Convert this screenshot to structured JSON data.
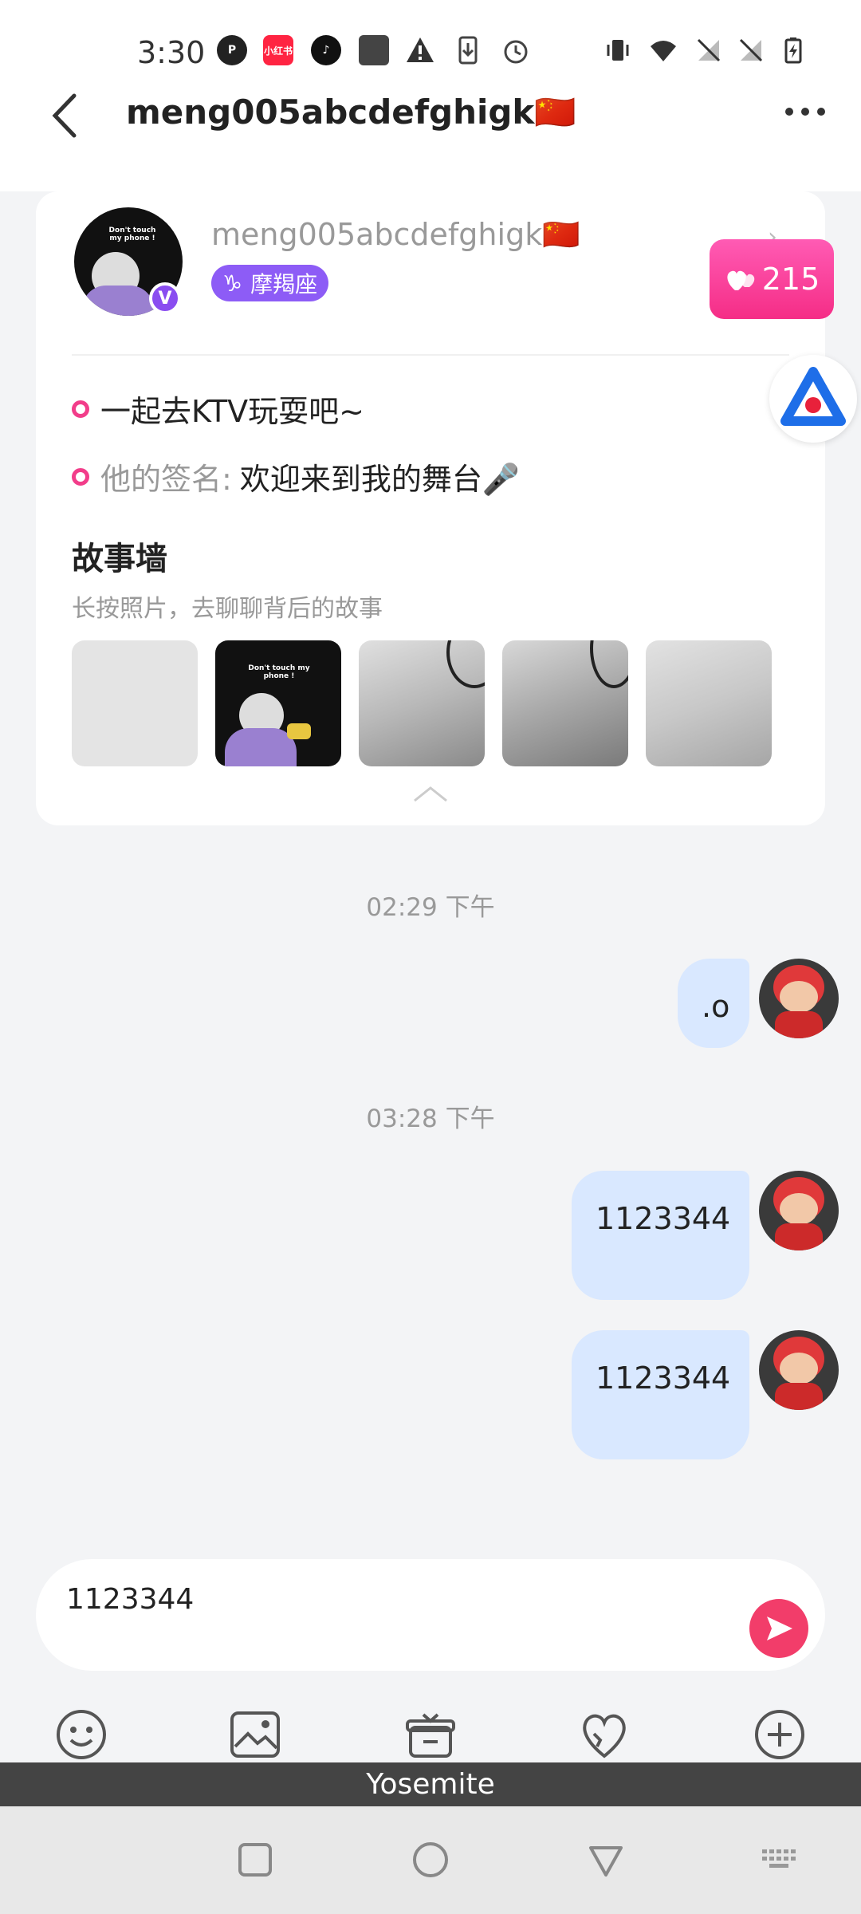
{
  "status_bar": {
    "time": "3:30",
    "app_icons": [
      "p-app-icon",
      "xiaohongshu-icon",
      "tiktok-icon",
      "wallet-icon",
      "warning-icon",
      "download-icon",
      "alarm-icon"
    ],
    "xiaohongshu_label": "小红书",
    "right_icons": [
      "vibrate-icon",
      "wifi-icon",
      "no-signal-icon",
      "no-signal-icon",
      "battery-charging-icon"
    ]
  },
  "header": {
    "title": "meng005abcdefghigk🇨🇳"
  },
  "profile": {
    "name": "meng005abcdefghigk🇨🇳",
    "badge": "V",
    "zodiac_symbol": "♑",
    "zodiac": "摩羯座",
    "likes": "215",
    "intro": "一起去KTV玩耍吧~",
    "signature_label": "他的签名:",
    "signature": "欢迎来到我的舞台🎤",
    "story_title": "故事墙",
    "story_subtitle": "长按照片，去聊聊背后的故事",
    "avatar_text": "Don't touch my phone !"
  },
  "chat": {
    "time1": "02:29 下午",
    "msg1": ".o",
    "time2": "03:28 下午",
    "msg2": "1123344",
    "msg3": "1123344"
  },
  "input": {
    "value": "1123344"
  },
  "keyboard": {
    "label": "Yosemite"
  },
  "colors": {
    "accent": "#f23d8a",
    "bubble": "#d9e8ff",
    "zodiac": "#8d5cf6"
  }
}
